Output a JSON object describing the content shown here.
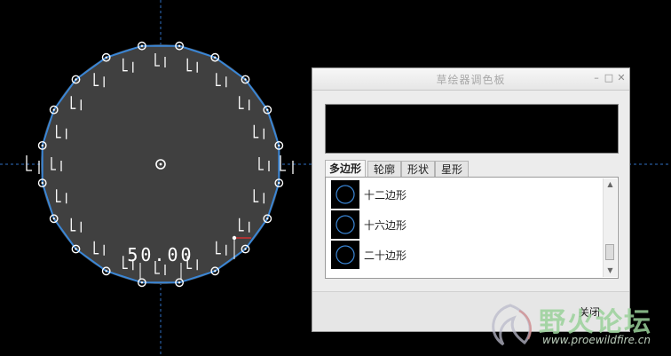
{
  "sketch": {
    "dimension_text": "50.00",
    "colors": {
      "background": "#000000",
      "circle_fill": "#404040",
      "polygon_edge": "#3a86d6",
      "centerline": "#2f6fc4",
      "vertex": "#ffffff",
      "constraint_text": "#ffffff"
    }
  },
  "palette": {
    "title": "草绘器调色板",
    "tabs": [
      {
        "label": "多边形",
        "active": true
      },
      {
        "label": "轮廓",
        "active": false
      },
      {
        "label": "形状",
        "active": false
      },
      {
        "label": "星形",
        "active": false
      }
    ],
    "items": [
      {
        "label": "十二边形",
        "icon": "circle-icon"
      },
      {
        "label": "十六边形",
        "icon": "circle-icon"
      },
      {
        "label": "二十边形",
        "icon": "circle-icon"
      }
    ],
    "close_label": "关闭"
  },
  "watermark": {
    "title": "野火论坛",
    "url": "www.proewildfire.cn"
  }
}
